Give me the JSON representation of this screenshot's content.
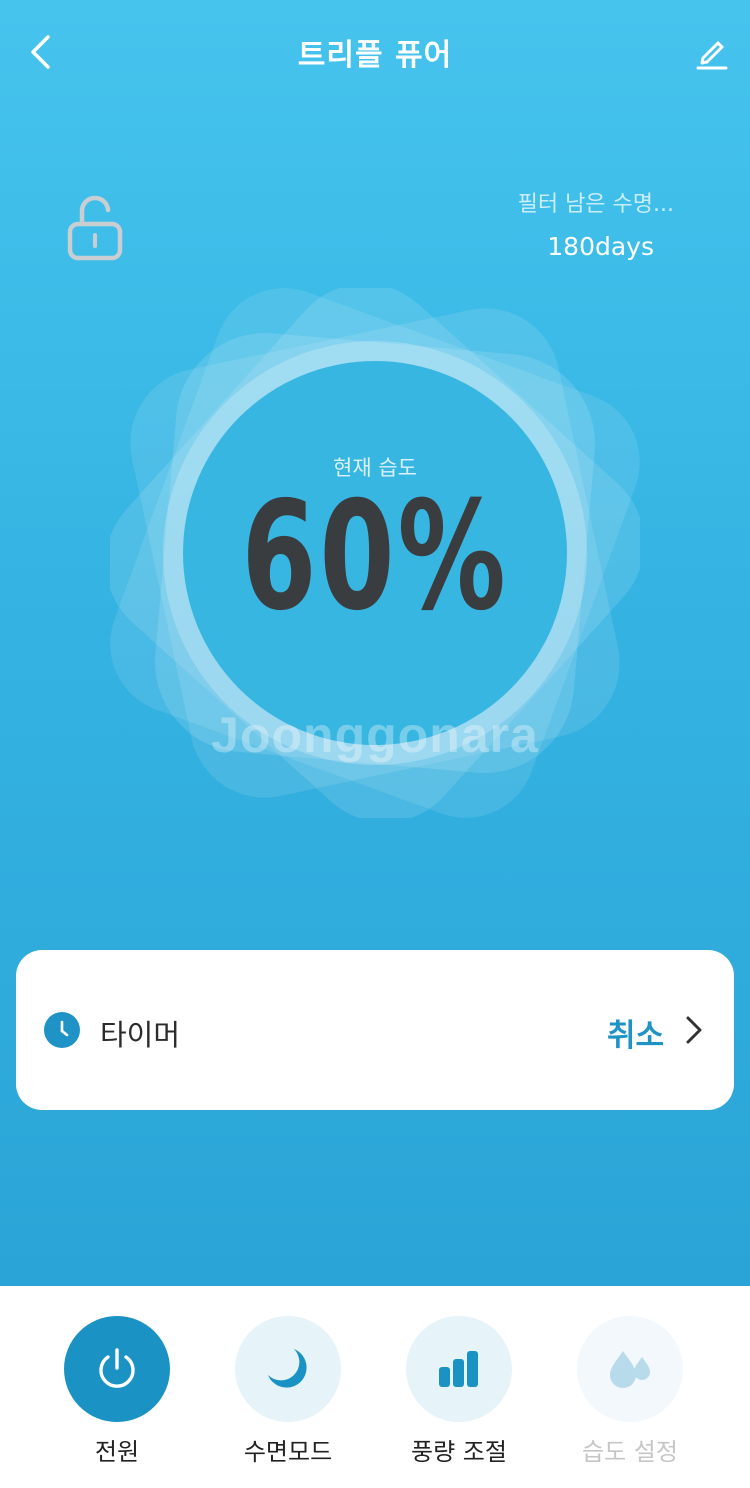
{
  "header": {
    "title": "트리플 퓨어"
  },
  "filter": {
    "label": "필터 남은 수명...",
    "value": "180days"
  },
  "humidity": {
    "label": "현재 습도",
    "value": "60%"
  },
  "watermark": "Joonggonara",
  "timer": {
    "label": "타이머",
    "action": "취소"
  },
  "controls": [
    {
      "label": "전원",
      "icon": "power-icon",
      "active": true
    },
    {
      "label": "수면모드",
      "icon": "moon-icon",
      "active": false
    },
    {
      "label": "풍량 조절",
      "icon": "fan-speed-icon",
      "active": false
    },
    {
      "label": "습도 설정",
      "icon": "droplets-icon",
      "active": false,
      "disabled": true
    }
  ],
  "colors": {
    "accent": "#1f93c6",
    "power_button": "#1a93c4",
    "inactive_button": "#e6f3f9",
    "background_top": "#46c4ee",
    "background_bottom": "#2aa4d6",
    "humidity_text": "#3a3d40"
  }
}
